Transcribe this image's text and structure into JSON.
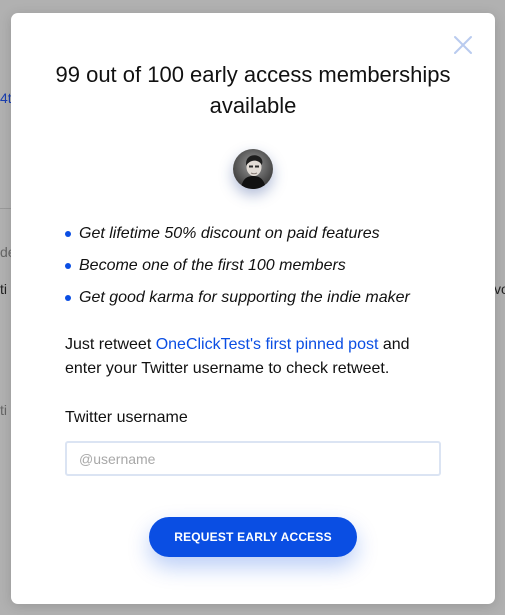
{
  "background": {
    "fragments": [
      "4t",
      "de",
      "ti",
      "vo",
      "ti"
    ]
  },
  "modal": {
    "title": "99 out of 100 early access memberships available",
    "benefits": [
      "Get lifetime 50% discount on paid features",
      "Become one of the first 100 members",
      "Get good karma for supporting the indie maker"
    ],
    "instruction": {
      "prefix": "Just retweet ",
      "link_text": "OneClickTest's first pinned post",
      "suffix": " and enter your Twitter username to check retweet."
    },
    "username": {
      "label": "Twitter username",
      "placeholder": "@username",
      "value": ""
    },
    "cta_label": "REQUEST EARLY ACCESS",
    "close_icon": "close-x-icon",
    "avatar_icon": "maker-avatar"
  },
  "colors": {
    "accent": "#0a4ee3",
    "close_icon": "#b9cbef",
    "overlay": "#7a7a7a"
  }
}
